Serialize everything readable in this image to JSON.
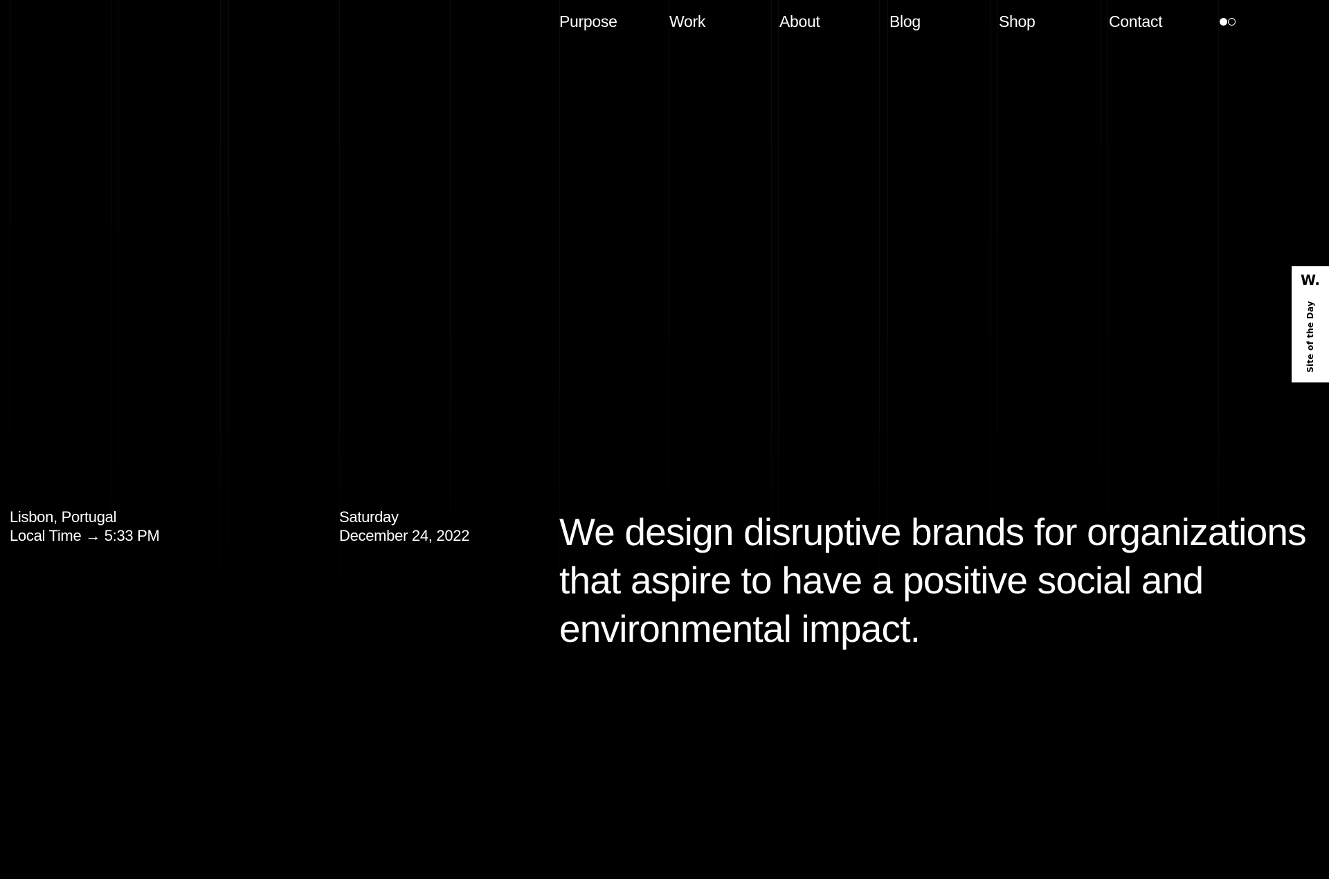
{
  "nav": {
    "items": [
      {
        "label": "Purpose"
      },
      {
        "label": "Work"
      },
      {
        "label": "About"
      },
      {
        "label": "Blog"
      },
      {
        "label": "Shop"
      },
      {
        "label": "Contact"
      }
    ],
    "theme_toggle_icon": "light-dark-toggle-icon"
  },
  "location": {
    "city": "Lisbon, Portugal",
    "local_time": "Local Time → 5:33 PM"
  },
  "date": {
    "weekday": "Saturday",
    "full_date": "December 24, 2022"
  },
  "headline": "We design disruptive brands for organizations that aspire to have a positive social and environmental impact.",
  "badge": {
    "logo": "W.",
    "label": "Site of the Day"
  },
  "colors": {
    "background": "#000000",
    "text": "#ffffff",
    "badge_background": "#ffffff",
    "badge_text": "#000000"
  }
}
